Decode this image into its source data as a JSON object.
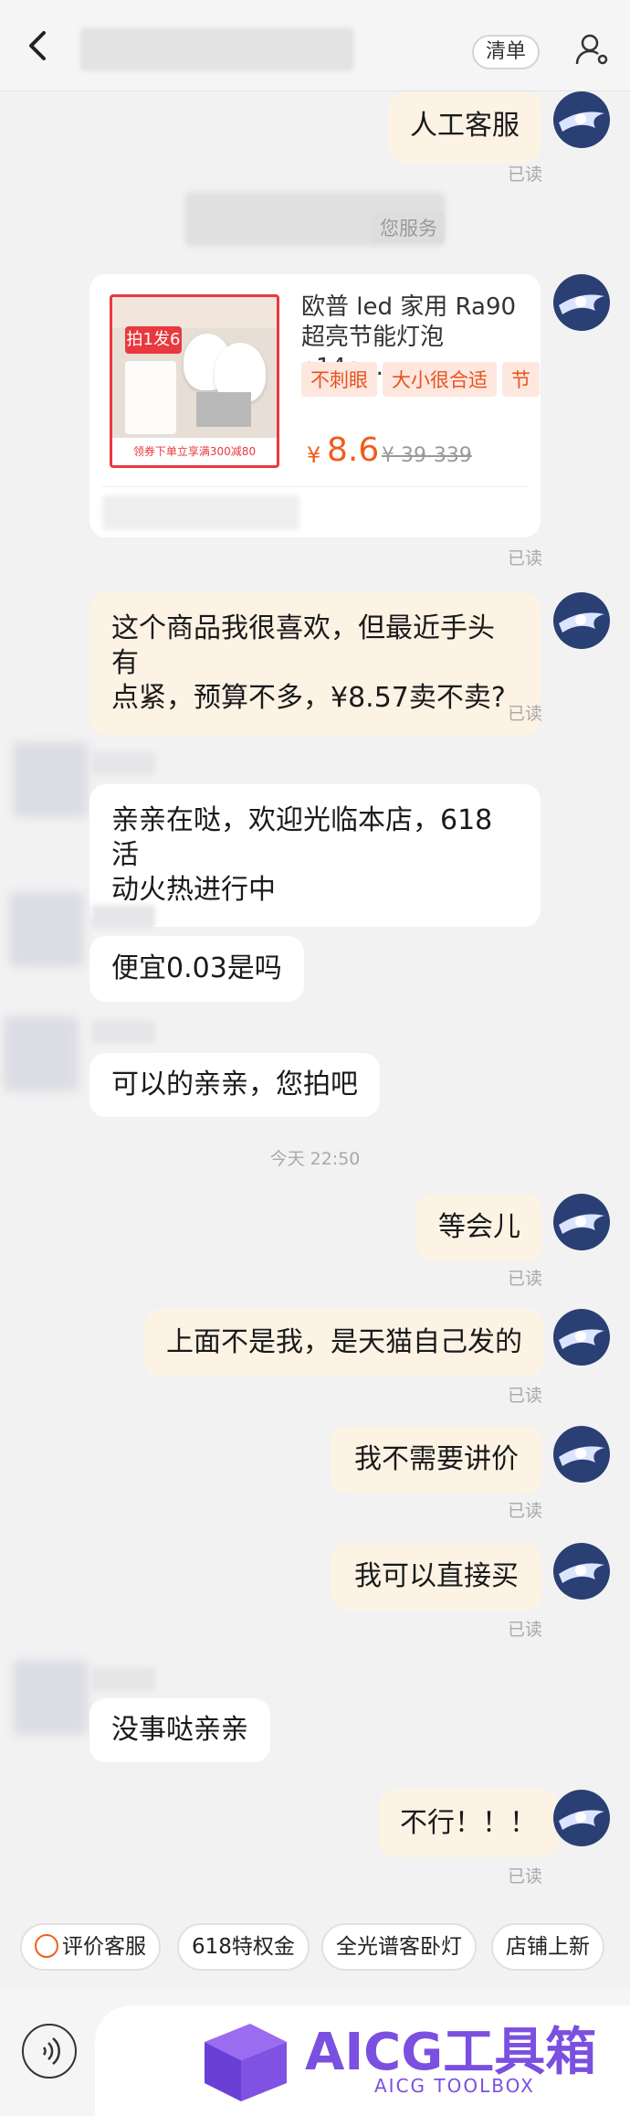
{
  "header": {
    "list_label": "清单"
  },
  "messages": [
    {
      "text": "人工客服",
      "read": "已读"
    },
    {
      "text": "这个商品我很喜欢，但最近手头有",
      "text2": "点紧，预算不多，¥8.57卖不卖?",
      "read": "已读"
    },
    {
      "text": "亲亲在哒，欢迎光临本店，618活",
      "text2": "动火热进行中"
    },
    {
      "text": "便宜0.03是吗"
    },
    {
      "text": "可以的亲亲，您拍吧"
    },
    {
      "text": "等会儿",
      "read": "已读"
    },
    {
      "text": "上面不是我，是天猫自己发的",
      "read": "已读"
    },
    {
      "text": "我不需要讲价",
      "read": "已读"
    },
    {
      "text": "我可以直接买",
      "read": "已读"
    },
    {
      "text": "没事哒亲亲"
    },
    {
      "text": "不行！！！",
      "read": "已读"
    }
  ],
  "service_notice": "您服务",
  "product_card": {
    "title": "欧普 led 家用 Ra90 超亮节能灯泡 e14e...",
    "tags": [
      "不刺眼",
      "大小很合适",
      "节"
    ],
    "currency": "¥",
    "price": "8.6",
    "original_price": "¥ 39-339",
    "read": "已读",
    "image_promo": "拍1发6",
    "image_footer": "领券下单立享满300减80"
  },
  "timestamp": "今天 22:50",
  "quick_replies": [
    "评价客服",
    "618特权金",
    "全光谱客卧灯",
    "店铺上新"
  ],
  "watermark": {
    "title": "AICG工具箱",
    "subtitle": "AICG TOOLBOX"
  },
  "colors": {
    "accent": "#f25b1c",
    "my_bubble": "#fdf3e5",
    "their_bubble": "#ffffff",
    "brand_purple": "#7b4fe0"
  }
}
